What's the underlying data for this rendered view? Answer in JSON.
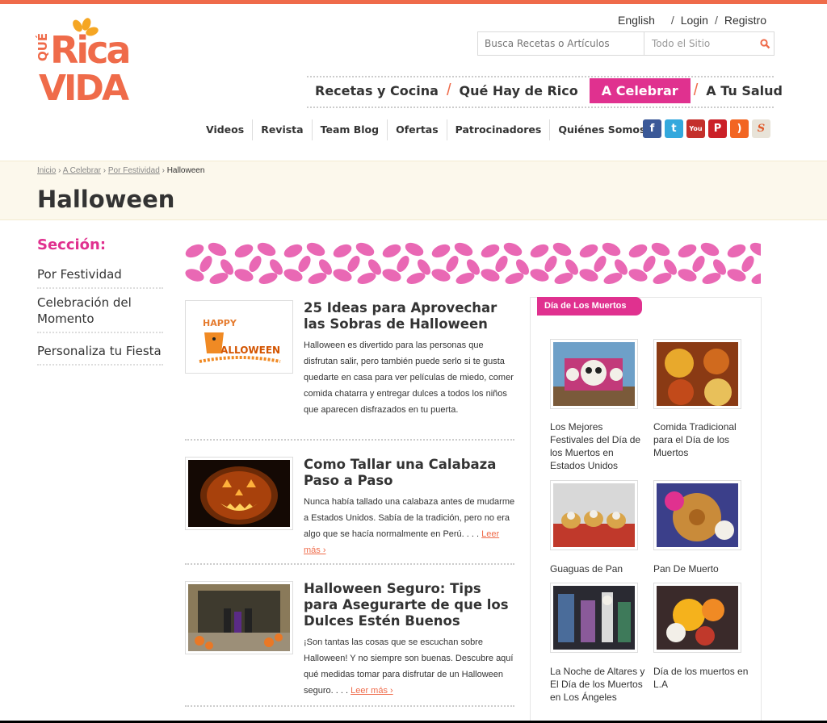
{
  "header": {
    "logo_text": [
      "QUÉ",
      "Rica",
      "VIDA"
    ],
    "toplinks": {
      "language": "English",
      "login": "Login",
      "register": "Registro",
      "sep": "/"
    },
    "search": {
      "placeholder": "Busca Recetas o Artículos",
      "scope": "Todo el Sitio"
    },
    "main_nav": [
      {
        "label": "Recetas y Cocina",
        "active": false
      },
      {
        "label": "Qué Hay de Rico",
        "active": false
      },
      {
        "label": "A Celebrar",
        "active": true
      },
      {
        "label": "A Tu Salud",
        "active": false
      }
    ],
    "nav_slash": "/",
    "secondary_nav": [
      "Videos",
      "Revista",
      "Team Blog",
      "Ofertas",
      "Patrocinadores",
      "Quiénes Somos"
    ],
    "social": [
      {
        "icon": "facebook-icon",
        "glyph": "f",
        "color": "#3b5998"
      },
      {
        "icon": "twitter-icon",
        "glyph": "t",
        "color": "#33a8dd"
      },
      {
        "icon": "youtube-icon",
        "glyph": "You",
        "color": "#c4302b"
      },
      {
        "icon": "pinterest-icon",
        "glyph": "P",
        "color": "#cb2027"
      },
      {
        "icon": "rss-icon",
        "glyph": ")",
        "color": "#f26522"
      },
      {
        "icon": "scribd-icon",
        "glyph": "S",
        "color": "#e8e3d8"
      }
    ]
  },
  "breadcrumb": {
    "items": [
      "Inicio",
      "A Celebrar",
      "Por Festividad"
    ],
    "current": "Halloween",
    "sep": "›"
  },
  "page_title": "Halloween",
  "sidebar": {
    "heading": "Sección:",
    "links": [
      "Por Festividad",
      "Celebración del Momento",
      "Personaliza tu Fiesta"
    ]
  },
  "articles": [
    {
      "title": "25 Ideas para Aprovechar las Sobras de Halloween",
      "excerpt": "Halloween es divertido para las personas que disfrutan salir, pero también puede serlo si te gusta quedarte en casa para ver películas de miedo, comer comida chatarra y entregar dulces a todos los niños que aparecen disfrazados en tu puerta.",
      "more": "",
      "thumb_text": [
        "HAPPY",
        "HALLOWEEN"
      ]
    },
    {
      "title": "Como Tallar una Calabaza Paso a Paso",
      "excerpt": "Nunca había tallado una calabaza antes de mudarme a Estados Unidos. Sabía de la tradición, pero no era algo que se hacía normalmente en Perú. . . .",
      "more": "Leer más ›"
    },
    {
      "title": "Halloween Seguro: Tips para Asegurarte de que los Dulces Estén Buenos",
      "excerpt": "¡Son tantas las cosas que se escuchan sobre Halloween! Y no siempre son buenas. Descubre aquí qué medidas tomar para disfrutar de un Halloween seguro. . . .",
      "more": "Leer más ›"
    }
  ],
  "featured": {
    "tag": "Día de Los Muertos",
    "items": [
      {
        "caption": "Los Mejores Festivales del Día de los Muertos en Estados Unidos"
      },
      {
        "caption": "Comida Tradicional para el Día de los Muertos"
      },
      {
        "caption": "Guaguas de Pan"
      },
      {
        "caption": "Pan De Muerto"
      },
      {
        "caption": "La Noche de Altares y El Día de los Muertos en Los Ángeles"
      },
      {
        "caption": "Día de los muertos en L.A"
      }
    ]
  },
  "colors": {
    "accent": "#e0318f",
    "brand": "#ef6b4a",
    "band": "#fcf8ec"
  }
}
